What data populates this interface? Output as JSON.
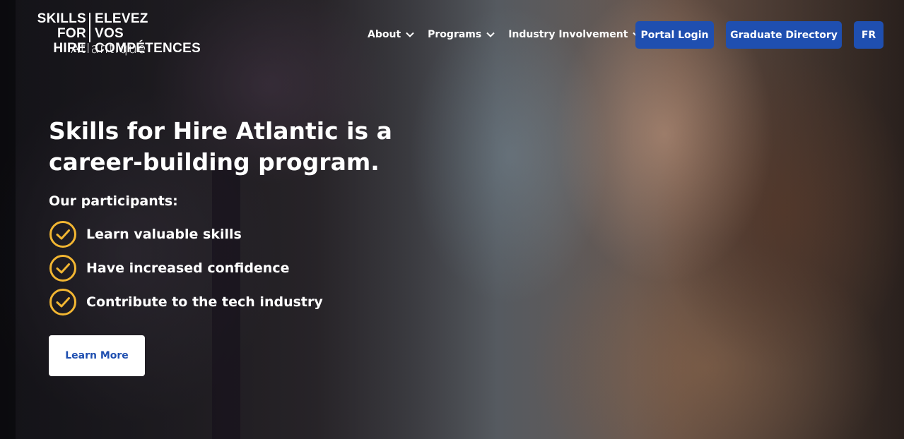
{
  "logo": {
    "line1_left": "SKILLS",
    "line2_left": "FOR HIRE",
    "line1_right": "ELEVEZ",
    "line2_right": "VOS COMPÉTENCES",
    "subtitle": "Atlantique"
  },
  "nav": {
    "items": [
      {
        "label": "About",
        "icon": "chevron-down-icon"
      },
      {
        "label": "Programs",
        "icon": "chevron-down-icon"
      },
      {
        "label": "Industry Involvement",
        "icon": "chevron-down-icon"
      }
    ],
    "portal_login": "Portal Login",
    "graduate_directory": "Graduate Directory",
    "language": "FR"
  },
  "hero": {
    "title": "Skills for Hire Atlantic is a career-building program.",
    "participants_label": "Our participants:",
    "benefits": [
      "Learn valuable skills",
      "Have increased confidence",
      "Contribute to the tech industry"
    ],
    "cta_label": "Learn More"
  },
  "colors": {
    "primary_blue": "#1f4fb0",
    "check_accent": "#f2b632",
    "text_white": "#ffffff"
  }
}
